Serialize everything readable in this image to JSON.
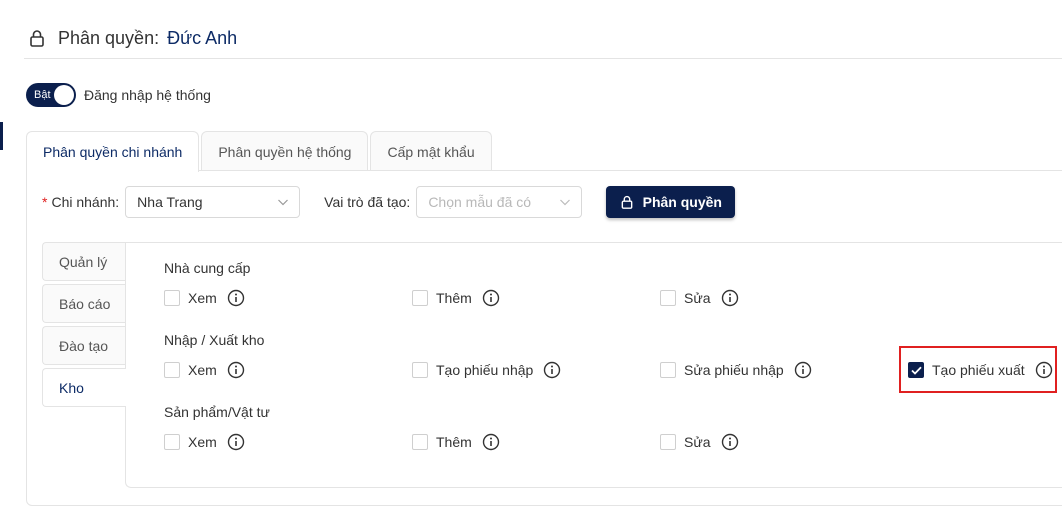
{
  "header": {
    "title_label": "Phân quyền:",
    "user_name": "Đức Anh"
  },
  "login": {
    "toggle_label": "Bật",
    "label": "Đăng nhập hệ thống",
    "enabled": true
  },
  "tabs": [
    {
      "label": "Phân quyền chi nhánh",
      "active": true
    },
    {
      "label": "Phân quyền hệ thống",
      "active": false
    },
    {
      "label": "Cấp mật khẩu",
      "active": false
    }
  ],
  "filters": {
    "branch_required": "*",
    "branch_label": "Chi nhánh:",
    "branch_value": "Nha Trang",
    "role_label": "Vai trò đã tạo:",
    "role_placeholder": "Chọn mẫu đã có",
    "submit_label": "Phân quyền"
  },
  "side_tabs": [
    {
      "label": "Quản lý",
      "active": false
    },
    {
      "label": "Báo cáo",
      "active": false
    },
    {
      "label": "Đào tạo",
      "active": false
    },
    {
      "label": "Kho",
      "active": true
    }
  ],
  "groups": [
    {
      "title": "Nhà cung cấp",
      "items": [
        {
          "label": "Xem",
          "checked": false
        },
        {
          "label": "Thêm",
          "checked": false
        },
        {
          "label": "Sửa",
          "checked": false
        }
      ]
    },
    {
      "title": "Nhập / Xuất kho",
      "items": [
        {
          "label": "Xem",
          "checked": false
        },
        {
          "label": "Tạo phiếu nhập",
          "checked": false
        },
        {
          "label": "Sửa phiếu nhập",
          "checked": false
        },
        {
          "label": "Tạo phiếu xuất",
          "checked": true
        }
      ]
    },
    {
      "title": "Sản phẩm/Vật tư",
      "items": [
        {
          "label": "Xem",
          "checked": false
        },
        {
          "label": "Thêm",
          "checked": false
        },
        {
          "label": "Sửa",
          "checked": false
        }
      ]
    }
  ],
  "colors": {
    "primary": "#0b1f4d",
    "title_accent": "#0d2b66",
    "highlight": "#e02020"
  },
  "icons": {
    "lock": "lock-icon",
    "info": "info-icon",
    "chevron": "chevron-down-icon",
    "check": "check-icon"
  }
}
